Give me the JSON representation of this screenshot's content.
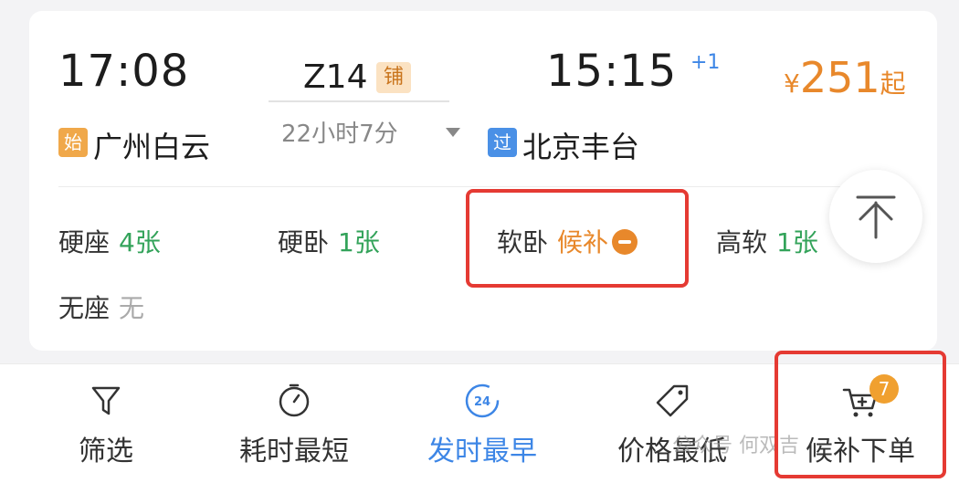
{
  "train": {
    "departure_time": "17:08",
    "arrival_time": "15:15",
    "day_offset": "+1",
    "train_no": "Z14",
    "berth_tag": "铺",
    "duration": "22小时7分",
    "departure_tag": "始",
    "departure_station": "广州白云",
    "arrival_tag": "过",
    "arrival_station": "北京丰台",
    "price_symbol": "¥",
    "price": "251",
    "price_suffix": "起"
  },
  "seats": [
    {
      "name": "硬座",
      "status": "4张"
    },
    {
      "name": "硬卧",
      "status": "1张"
    },
    {
      "name": "软卧",
      "status": "候补"
    },
    {
      "name": "高软",
      "status": "1张"
    },
    {
      "name": "无座",
      "status": "无"
    }
  ],
  "toolbar": {
    "items": [
      {
        "label": "筛选",
        "icon": "filter-icon"
      },
      {
        "label": "耗时最短",
        "icon": "timer-icon"
      },
      {
        "label": "发时最早",
        "icon": "clock-24-icon",
        "active": true,
        "icon_text": "24"
      },
      {
        "label": "价格最低",
        "icon": "price-tag-icon"
      },
      {
        "label": "候补下单",
        "icon": "cart-plus-icon",
        "badge": "7"
      }
    ]
  },
  "watermark": "公众号 何双吉",
  "colors": {
    "accent_blue": "#3d86e6",
    "price_orange": "#e8882b",
    "available_green": "#33a35a",
    "highlight_red": "#e53a33"
  }
}
